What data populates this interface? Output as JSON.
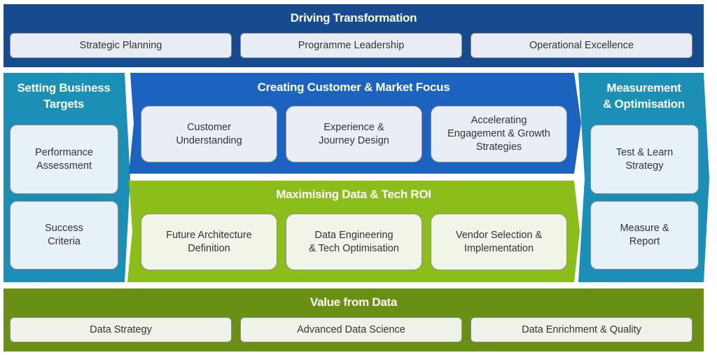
{
  "colors": {
    "top_band": "#174b8f",
    "side_panels": "#1b8fb5",
    "customer_panel": "#1c63c0",
    "data_tech_panel": "#8bbd1b",
    "bottom_band": "#6a8f15"
  },
  "top": {
    "title": "Driving Transformation",
    "items": [
      "Strategic Planning",
      "Programme Leadership",
      "Operational Excellence"
    ]
  },
  "left": {
    "title_line1": "Setting Business",
    "title_line2": "Targets",
    "items": [
      {
        "line1": "Performance",
        "line2": "Assessment"
      },
      {
        "line1": "Success",
        "line2": "Criteria"
      }
    ]
  },
  "customer": {
    "title": "Creating Customer & Market Focus",
    "items": [
      {
        "line1": "Customer",
        "line2": "Understanding",
        "line3": ""
      },
      {
        "line1": "Experience &",
        "line2": "Journey Design",
        "line3": ""
      },
      {
        "line1": "Accelerating",
        "line2": "Engagement & Growth",
        "line3": "Strategies"
      }
    ]
  },
  "datatech": {
    "title": "Maximising Data & Tech ROI",
    "items": [
      {
        "line1": "Future Architecture",
        "line2": "Definition"
      },
      {
        "line1": "Data Engineering",
        "line2": "& Tech Optimisation"
      },
      {
        "line1": "Vendor Selection &",
        "line2": "Implementation"
      }
    ]
  },
  "right": {
    "title_line1": "Measurement",
    "title_line2": "& Optimisation",
    "items": [
      {
        "line1": "Test & Learn",
        "line2": "Strategy"
      },
      {
        "line1": "Measure &",
        "line2": "Report"
      }
    ]
  },
  "bottom": {
    "title": "Value from Data",
    "items": [
      "Data Strategy",
      "Advanced Data Science",
      "Data Enrichment & Quality"
    ]
  }
}
